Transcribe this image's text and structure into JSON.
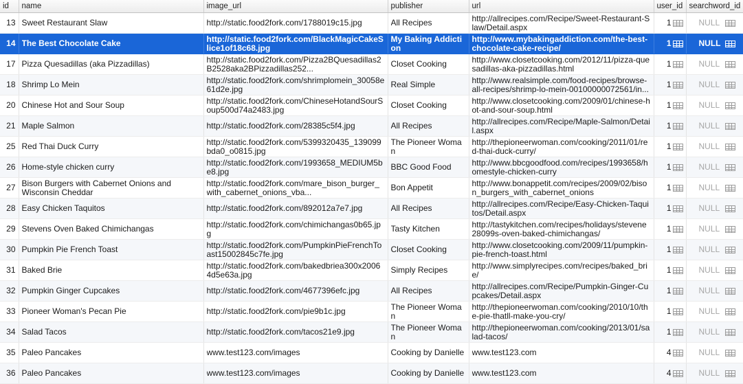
{
  "columns": [
    "id",
    "name",
    "image_url",
    "publisher",
    "url",
    "user_id",
    "searchword_id"
  ],
  "colors": {
    "selection": "#1a66d8",
    "null_text": "#a6a6a6"
  },
  "icons": {
    "foreign_key": "table-grid-icon"
  },
  "selected_row_index": 1,
  "rows": [
    {
      "id": "13",
      "name": "Sweet Restaurant Slaw",
      "image_url": "http://static.food2fork.com/1788019c15.jpg",
      "publisher": "All Recipes",
      "url": "http://allrecipes.com/Recipe/Sweet-Restaurant-Slaw/Detail.aspx",
      "user_id": "1",
      "searchword_id": "NULL"
    },
    {
      "id": "14",
      "name": "The Best Chocolate Cake",
      "image_url": "http://static.food2fork.com/BlackMagicCakeSlice1of18c68.jpg",
      "publisher": "My Baking Addiction",
      "url": "http://www.mybakingaddiction.com/the-best-chocolate-cake-recipe/",
      "user_id": "1",
      "searchword_id": "NULL"
    },
    {
      "id": "17",
      "name": "Pizza Quesadillas (aka Pizzadillas)",
      "image_url": "http://static.food2fork.com/Pizza2BQuesadillas2B2528aka2BPizzadillas252...",
      "publisher": "Closet Cooking",
      "url": "http://www.closetcooking.com/2012/11/pizza-quesadillas-aka-pizzadillas.html",
      "user_id": "1",
      "searchword_id": "NULL"
    },
    {
      "id": "18",
      "name": "Shrimp Lo Mein",
      "image_url": "http://static.food2fork.com/shrimplomein_30058e61d2e.jpg",
      "publisher": "Real Simple",
      "url": "http://www.realsimple.com/food-recipes/browse-all-recipes/shrimp-lo-mein-00100000072561/in...",
      "user_id": "1",
      "searchword_id": "NULL"
    },
    {
      "id": "20",
      "name": "Chinese Hot and Sour Soup",
      "image_url": "http://static.food2fork.com/ChineseHotandSourSoup500d74a2483.jpg",
      "publisher": "Closet Cooking",
      "url": "http://www.closetcooking.com/2009/01/chinese-hot-and-sour-soup.html",
      "user_id": "1",
      "searchword_id": "NULL"
    },
    {
      "id": "21",
      "name": "Maple Salmon",
      "image_url": "http://static.food2fork.com/28385c5f4.jpg",
      "publisher": "All Recipes",
      "url": "http://allrecipes.com/Recipe/Maple-Salmon/Detail.aspx",
      "user_id": "1",
      "searchword_id": "NULL"
    },
    {
      "id": "25",
      "name": "Red Thai Duck Curry",
      "image_url": "http://static.food2fork.com/5399320435_139099bda0_o0815.jpg",
      "publisher": "The Pioneer Woman",
      "url": "http://thepioneerwoman.com/cooking/2011/01/red-thai-duck-curry/",
      "user_id": "1",
      "searchword_id": "NULL"
    },
    {
      "id": "26",
      "name": "Home-style chicken curry",
      "image_url": "http://static.food2fork.com/1993658_MEDIUM5be8.jpg",
      "publisher": "BBC Good Food",
      "url": "http://www.bbcgoodfood.com/recipes/1993658/homestyle-chicken-curry",
      "user_id": "1",
      "searchword_id": "NULL"
    },
    {
      "id": "27",
      "name": "Bison Burgers with Cabernet Onions and Wisconsin Cheddar",
      "image_url": "http://static.food2fork.com/mare_bison_burger_with_cabernet_onions_vba...",
      "publisher": "Bon Appetit",
      "url": "http://www.bonappetit.com/recipes/2009/02/bison_burgers_with_cabernet_onions",
      "user_id": "1",
      "searchword_id": "NULL"
    },
    {
      "id": "28",
      "name": "Easy Chicken Taquitos",
      "image_url": "http://static.food2fork.com/892012a7e7.jpg",
      "publisher": "All Recipes",
      "url": "http://allrecipes.com/Recipe/Easy-Chicken-Taquitos/Detail.aspx",
      "user_id": "1",
      "searchword_id": "NULL"
    },
    {
      "id": "29",
      "name": "Stevens Oven Baked Chimichangas",
      "image_url": "http://static.food2fork.com/chimichangas0b65.jpg",
      "publisher": "Tasty Kitchen",
      "url": "http://tastykitchen.com/recipes/holidays/stevene28099s-oven-baked-chimichangas/",
      "user_id": "1",
      "searchword_id": "NULL"
    },
    {
      "id": "30",
      "name": "Pumpkin Pie French Toast",
      "image_url": "http://static.food2fork.com/PumpkinPieFrenchToast15002845c7fe.jpg",
      "publisher": "Closet Cooking",
      "url": "http://www.closetcooking.com/2009/11/pumpkin-pie-french-toast.html",
      "user_id": "1",
      "searchword_id": "NULL"
    },
    {
      "id": "31",
      "name": "Baked Brie",
      "image_url": "http://static.food2fork.com/bakedbriea300x20064d5e63a.jpg",
      "publisher": "Simply Recipes",
      "url": "http://www.simplyrecipes.com/recipes/baked_brie/",
      "user_id": "1",
      "searchword_id": "NULL"
    },
    {
      "id": "32",
      "name": "Pumpkin Ginger Cupcakes",
      "image_url": "http://static.food2fork.com/4677396efc.jpg",
      "publisher": "All Recipes",
      "url": "http://allrecipes.com/Recipe/Pumpkin-Ginger-Cupcakes/Detail.aspx",
      "user_id": "1",
      "searchword_id": "NULL"
    },
    {
      "id": "33",
      "name": "Pioneer Woman's Pecan Pie",
      "image_url": "http://static.food2fork.com/pie9b1c.jpg",
      "publisher": "The Pioneer Woman",
      "url": "http://thepioneerwoman.com/cooking/2010/10/the-pie-thatll-make-you-cry/",
      "user_id": "1",
      "searchword_id": "NULL"
    },
    {
      "id": "34",
      "name": "Salad Tacos",
      "image_url": "http://static.food2fork.com/tacos21e9.jpg",
      "publisher": "The Pioneer Woman",
      "url": "http://thepioneerwoman.com/cooking/2013/01/salad-tacos/",
      "user_id": "1",
      "searchword_id": "NULL"
    },
    {
      "id": "35",
      "name": "Paleo Pancakes",
      "image_url": "www.test123.com/images",
      "publisher": "Cooking by Danielle",
      "url": "www.test123.com",
      "user_id": "4",
      "searchword_id": "NULL"
    },
    {
      "id": "36",
      "name": "Paleo Pancakes",
      "image_url": "www.test123.com/images",
      "publisher": "Cooking by Danielle",
      "url": "www.test123.com",
      "user_id": "4",
      "searchword_id": "NULL"
    }
  ]
}
